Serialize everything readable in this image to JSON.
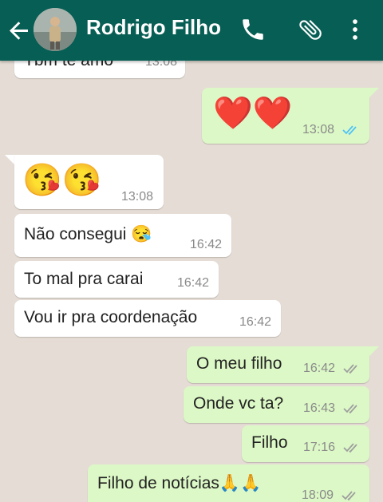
{
  "header": {
    "title": "Rodrigo Filho",
    "colors": {
      "bar": "#075e54",
      "icon": "#ffffff"
    },
    "icons": [
      "back-arrow-icon",
      "phone-icon",
      "paperclip-icon",
      "more-vert-icon"
    ]
  },
  "messages": [
    {
      "dir": "in",
      "text": "Tbm te amo",
      "time": "13:08"
    },
    {
      "dir": "out",
      "text": "❤️❤️",
      "time": "13:08",
      "status": "read"
    },
    {
      "dir": "in",
      "text": "😘😘",
      "time": "13:08"
    },
    {
      "dir": "in",
      "text": "Não consegui 😪",
      "time": "16:42"
    },
    {
      "dir": "in",
      "text": "To mal pra carai",
      "time": "16:42"
    },
    {
      "dir": "in",
      "text": "Vou ir pra coordenação",
      "time": "16:42"
    },
    {
      "dir": "out",
      "text": "O meu filho",
      "time": "16:42",
      "status": "delivered"
    },
    {
      "dir": "out",
      "text": "Onde vc ta?",
      "time": "16:43",
      "status": "delivered"
    },
    {
      "dir": "out",
      "text": "Filho",
      "time": "17:16",
      "status": "delivered"
    },
    {
      "dir": "out",
      "text": "Filho de notícias🙏🙏",
      "time": "18:09",
      "status": "delivered"
    }
  ],
  "colors": {
    "incoming": "#ffffff",
    "outgoing": "#dcf8c6",
    "read_tick": "#4fc3f7",
    "tick": "#9e9e9e"
  }
}
